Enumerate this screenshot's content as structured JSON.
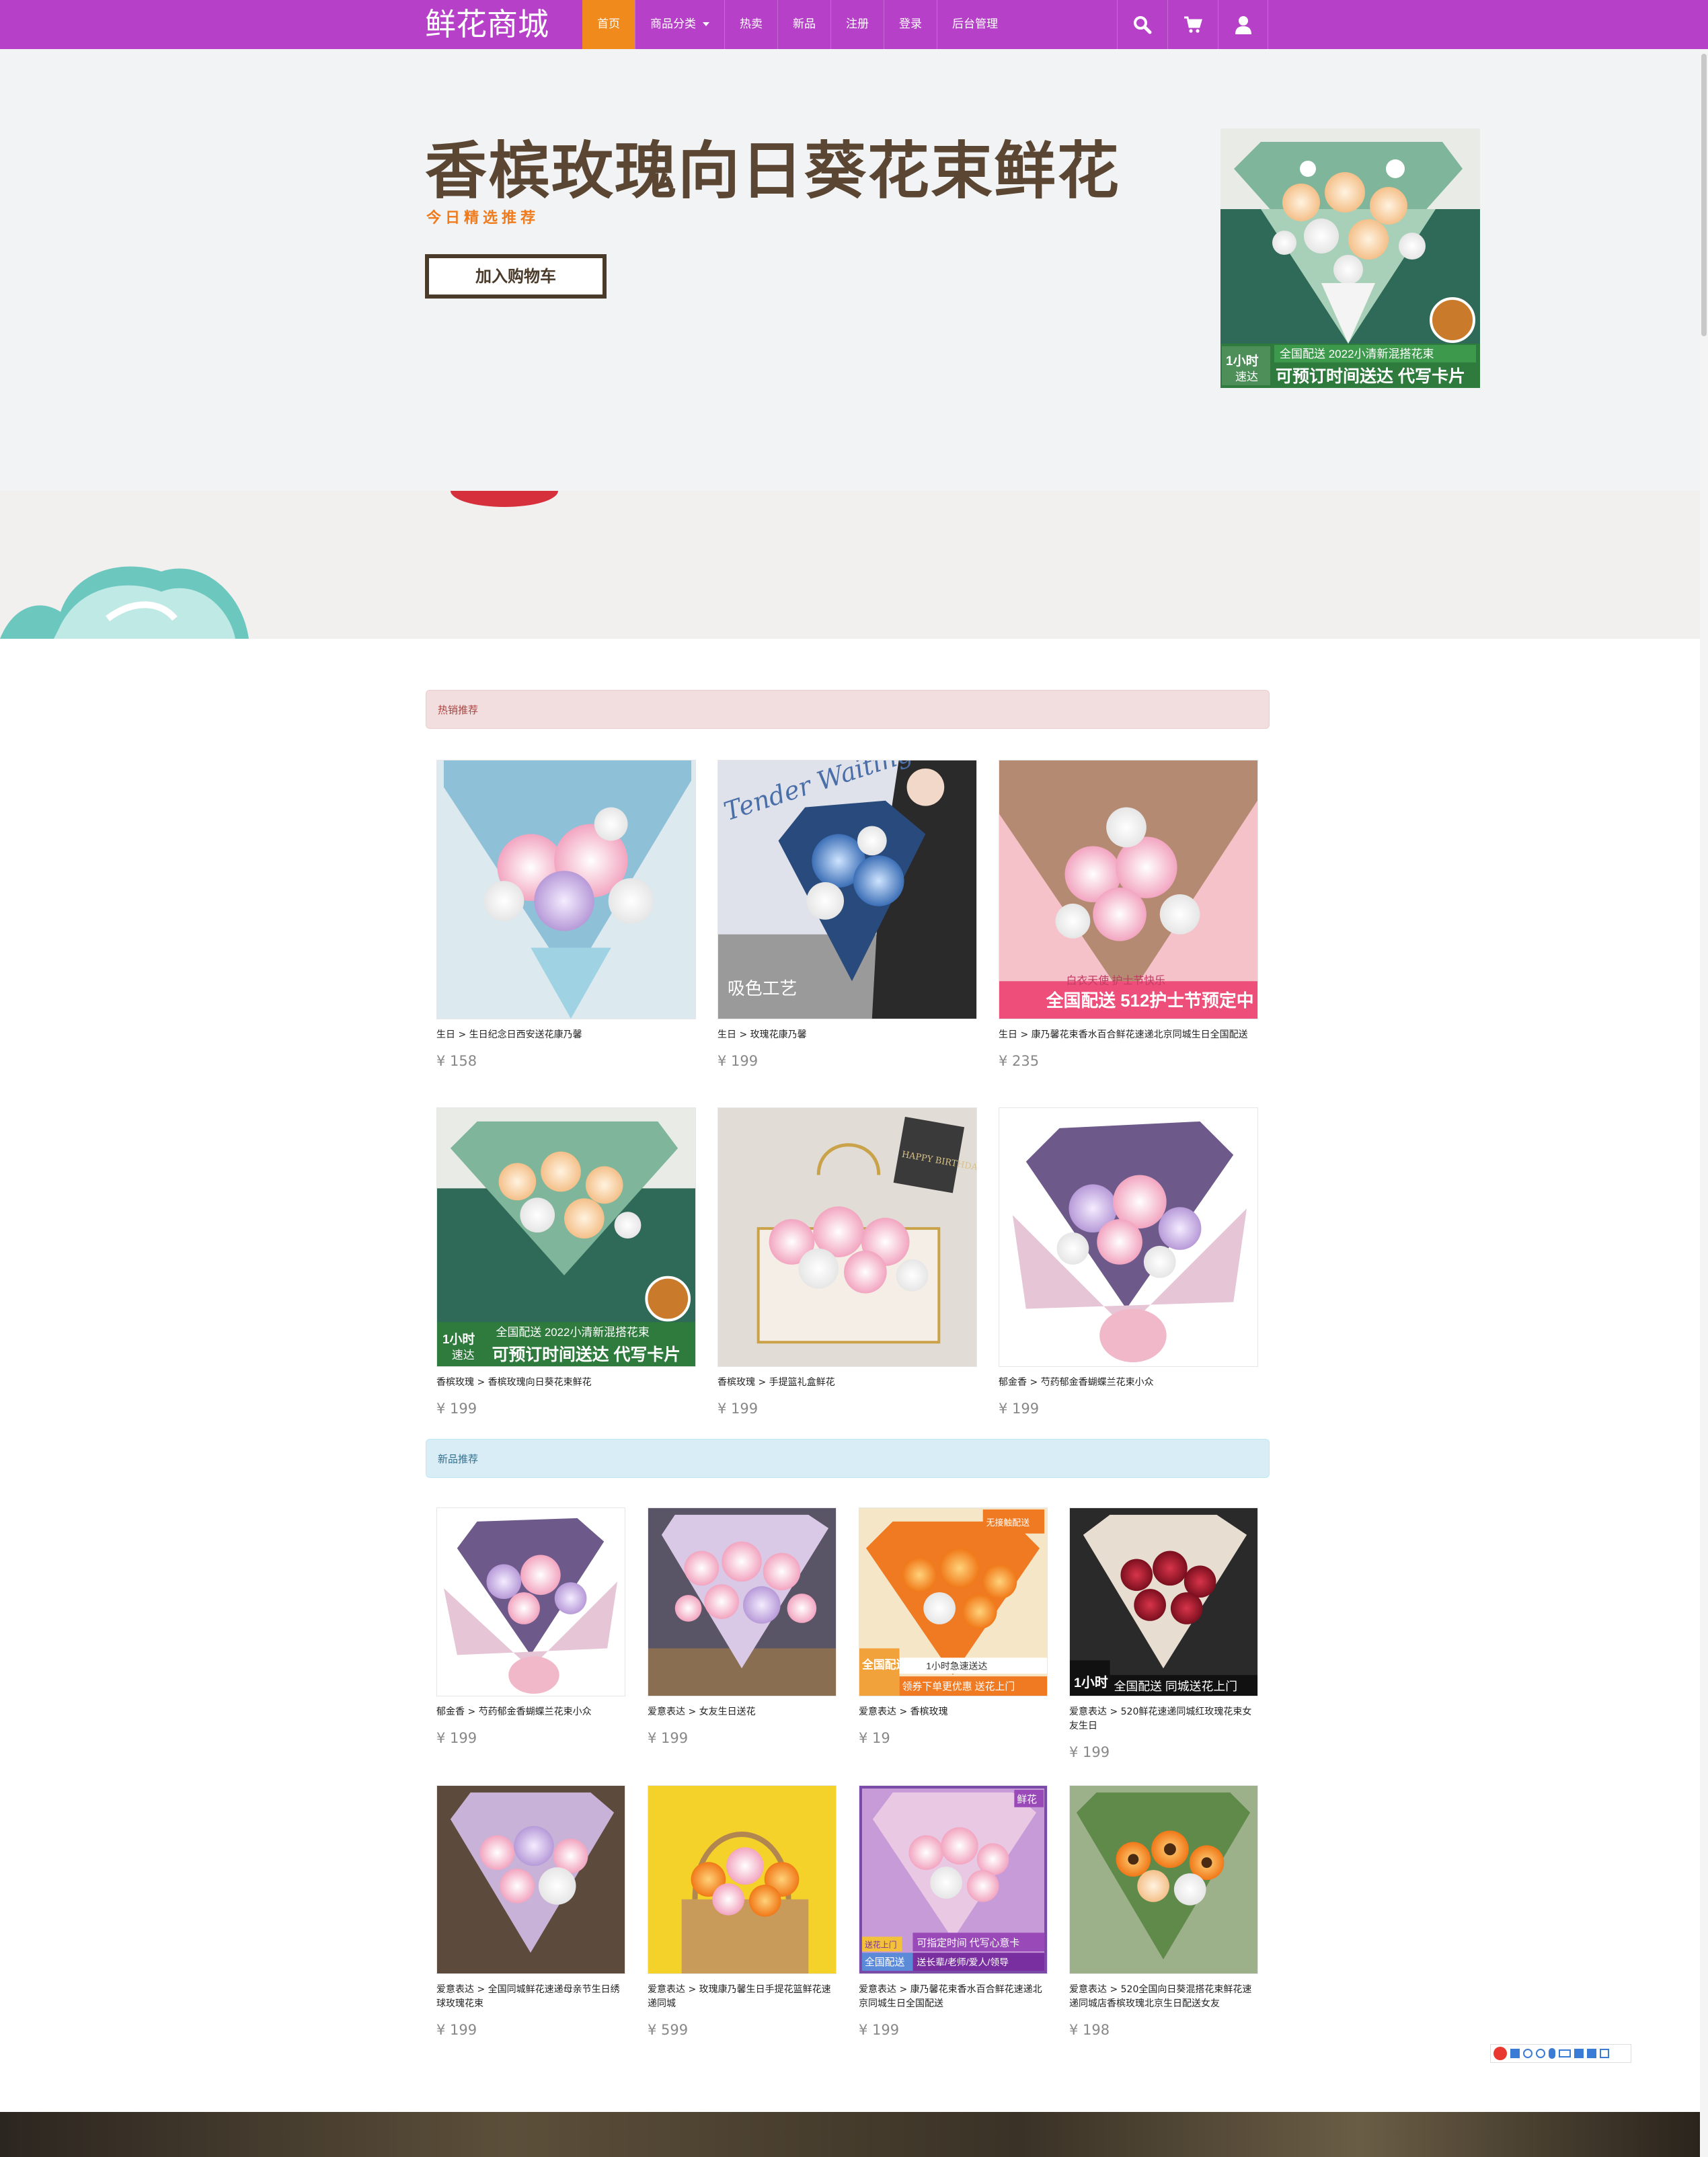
{
  "navbar": {
    "brand": "鲜花商城",
    "items": [
      {
        "label": "首页",
        "active": true
      },
      {
        "label": "商品分类",
        "dropdown": true
      },
      {
        "label": "热卖"
      },
      {
        "label": "新品"
      },
      {
        "label": "注册"
      },
      {
        "label": "登录"
      },
      {
        "label": "后台管理"
      }
    ],
    "icons": [
      "search-icon",
      "cart-icon",
      "user-icon"
    ]
  },
  "hero": {
    "title": "香槟玫瑰向日葵花束鲜花",
    "subtitle": "今日精选推荐",
    "button": "加入购物车",
    "image_texts": [
      "全国配送 2022小清新混搭花束",
      "可预订时间送达 代写卡片",
      "1小时",
      "速达"
    ]
  },
  "hot": {
    "heading": "热销推荐",
    "items": [
      {
        "caption": "生日 > 生日纪念日西安送花康乃馨",
        "price": "¥ 158"
      },
      {
        "caption": "生日 > 玫瑰花康乃馨",
        "price": "¥ 199",
        "image_texts": [
          "Tender Waiting",
          "吸色工艺"
        ]
      },
      {
        "caption": "生日 > 康乃馨花束香水百合鲜花速递北京同城生日全国配送",
        "price": "¥ 235",
        "image_texts": [
          "全国配送 512护士节预定中",
          "白衣天使 护士节快乐"
        ]
      },
      {
        "caption": "香槟玫瑰 > 香槟玫瑰向日葵花束鲜花",
        "price": "¥ 199",
        "image_texts": [
          "全国配送 2022小清新混搭花束",
          "可预订时间送达 代写卡片",
          "1小时",
          "速达"
        ]
      },
      {
        "caption": "香槟玫瑰 > 手提篮礼盒鲜花",
        "price": "¥ 199",
        "image_texts": [
          "HAPPY BIRTHDAY"
        ]
      },
      {
        "caption": "郁金香 > 芍药郁金香蝴蝶兰花束小众",
        "price": "¥ 199"
      }
    ]
  },
  "new": {
    "heading": "新品推荐",
    "items": [
      {
        "caption": "郁金香 > 芍药郁金香蝴蝶兰花束小众",
        "price": "¥ 199"
      },
      {
        "caption": "爱意表达 > 女友生日送花",
        "price": "¥ 199"
      },
      {
        "caption": "爱意表达 > 香槟玫瑰",
        "price": "¥ 19",
        "image_texts": [
          "全国配送",
          "1小时急速送达",
          "领券下单更优惠 送花上门",
          "无接触配送"
        ]
      },
      {
        "caption": "爱意表达 > 520鲜花速递同城红玫瑰花束女友生日",
        "price": "¥ 199",
        "image_texts": [
          "1小时",
          "全国配送 同城送花上门"
        ]
      },
      {
        "caption": "爱意表达 > 全国同城鲜花速递母亲节生日绣球玫瑰花束",
        "price": "¥ 199"
      },
      {
        "caption": "爱意表达 > 玫瑰康乃馨生日手提花篮鲜花速递同城",
        "price": "¥ 599"
      },
      {
        "caption": "爱意表达 > 康乃馨花束香水百合鲜花速递北京同城生日全国配送",
        "price": "¥ 199",
        "image_texts": [
          "鲜花",
          "可指定时间 代写心意卡",
          "送长辈/老师/爱人/领导",
          "全国配送",
          "送花上门"
        ]
      },
      {
        "caption": "爱意表达 > 520全国向日葵混搭花束鲜花速递同城店香槟玫瑰北京生日配送女友",
        "price": "¥ 198"
      }
    ]
  },
  "colors": {
    "navbar": "#b640c8",
    "active_nav": "#f08a1c",
    "hero_bg": "#f1f3f4",
    "hero_title": "#5a4632",
    "accent": "#f07b1c"
  }
}
